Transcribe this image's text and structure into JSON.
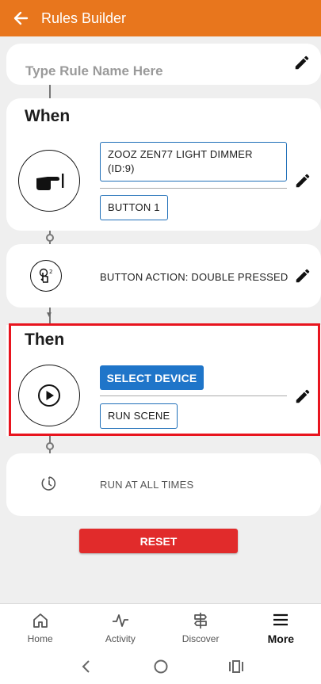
{
  "app_bar": {
    "title": "Rules Builder"
  },
  "rule_name": {
    "placeholder": "Type Rule Name Here"
  },
  "when": {
    "title": "When",
    "device_chip": "ZOOZ ZEN77 LIGHT DIMMER (ID:9)",
    "button_chip": "BUTTON 1",
    "action_text": "BUTTON ACTION: DOUBLE PRESSED"
  },
  "then": {
    "title": "Then",
    "select_device_label": "SELECT DEVICE",
    "run_scene_chip": "RUN SCENE"
  },
  "schedule": {
    "text": "RUN AT ALL TIMES"
  },
  "reset_label": "RESET",
  "nav": {
    "home": "Home",
    "activity": "Activity",
    "discover": "Discover",
    "more": "More"
  },
  "colors": {
    "app_bar": "#e8761d",
    "primary_blue": "#1f75c9",
    "reset_red": "#e12b2b",
    "highlight_red": "#e8141e"
  },
  "icons": [
    "back-arrow-icon",
    "pencil-icon",
    "hand-press-icon",
    "double-tap-icon",
    "play-icon",
    "timer-icon",
    "home-icon",
    "activity-icon",
    "discover-icon",
    "menu-icon",
    "system-back-icon",
    "system-home-icon",
    "system-recents-icon"
  ]
}
